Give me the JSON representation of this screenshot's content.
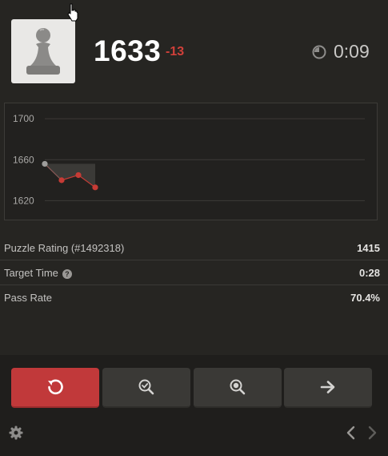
{
  "header": {
    "avatar_icon": "pawn-icon",
    "rating": "1633",
    "rating_delta": "-13",
    "timer_icon": "clock-pie-icon",
    "timer": "0:09"
  },
  "chart_data": {
    "type": "line",
    "x": [
      1,
      2,
      3,
      4
    ],
    "series": [
      {
        "values": [
          1656,
          1640,
          1645,
          1633
        ]
      }
    ],
    "ylim": [
      1600,
      1715
    ],
    "yticks": [
      "1700",
      "1660",
      "1620"
    ],
    "grid": true,
    "colors": {
      "start_point": "#9e9d9b",
      "points": "#c63b35",
      "line": "#c63b35",
      "area": "#3b3a37"
    }
  },
  "stats": {
    "puzzle_rating_label": "Puzzle Rating (#1492318)",
    "puzzle_rating_value": "1415",
    "target_time_label": "Target Time",
    "target_time_value": "0:28",
    "pass_rate_label": "Pass Rate",
    "pass_rate_value": "70.4%"
  },
  "actions": {
    "retry_icon": "retry-icon",
    "analysis_icon": "magnify-check-icon",
    "solution_icon": "magnify-star-icon",
    "next_icon": "arrow-right-icon"
  },
  "colors": {
    "background": "#262522",
    "accent_red": "#c1393a",
    "button": "#3a3936"
  }
}
